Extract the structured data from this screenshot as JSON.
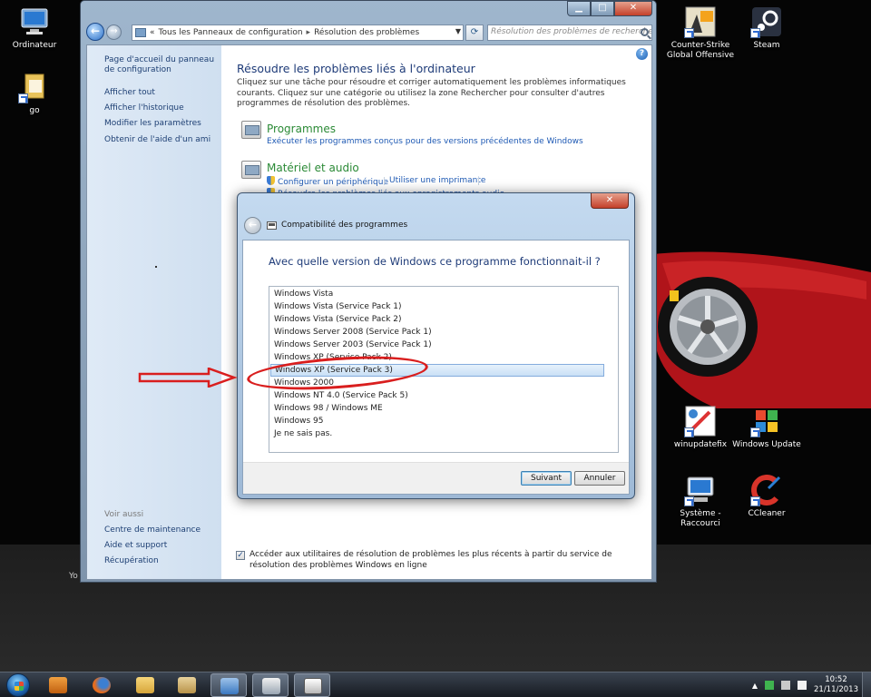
{
  "desktop": {
    "icons": [
      {
        "label": "Ordinateur"
      },
      {
        "label": "go"
      },
      {
        "label": "Counter-Strike Global Offensive"
      },
      {
        "label": "Steam"
      },
      {
        "label": "winupdatefix"
      },
      {
        "label": "Windows Update"
      },
      {
        "label": "Système - Raccourci"
      },
      {
        "label": "CCleaner"
      }
    ],
    "stray_text": "Yo"
  },
  "window": {
    "addr": {
      "part1": "Tous les Panneaux de configuration",
      "part2": "Résolution des problèmes"
    },
    "search_placeholder": "Résolution des problèmes de recherche",
    "left_pane": {
      "links": [
        "Page d'accueil du panneau de configuration",
        "Afficher tout",
        "Afficher l'historique",
        "Modifier les paramètres",
        "Obtenir de l'aide d'un ami"
      ],
      "see_also_heading": "Voir aussi",
      "see_also": [
        "Centre de maintenance",
        "Aide et support",
        "Récupération"
      ]
    },
    "title": "Résoudre les problèmes liés à l'ordinateur",
    "intro": "Cliquez sur une tâche pour résoudre et corriger automatiquement les problèmes informatiques courants. Cliquez sur une catégorie ou utilisez la zone Rechercher pour consulter d'autres programmes de résolution des problèmes.",
    "categories": {
      "programmes": {
        "title": "Programmes",
        "link1": "Exécuter les programmes conçus pour des versions précédentes de Windows"
      },
      "materiel": {
        "title": "Matériel et audio",
        "link1": "Configurer un périphérique",
        "link2": "Utiliser une imprimante",
        "link3": "Résoudre les problèmes liés aux enregistrements audio"
      }
    },
    "checkbox_label": "Accéder aux utilitaires de résolution de problèmes les plus récents à partir du service de résolution des problèmes Windows en ligne",
    "checkbox_checked": true
  },
  "dialog": {
    "title": "Compatibilité des programmes",
    "heading": "Avec quelle version de Windows ce programme fonctionnait-il ?",
    "options": [
      "Windows Vista",
      "Windows Vista (Service Pack 1)",
      "Windows Vista (Service Pack 2)",
      "Windows Server 2008 (Service Pack 1)",
      "Windows Server 2003 (Service Pack 1)",
      "Windows XP (Service Pack 2)",
      "Windows XP (Service Pack 3)",
      "Windows 2000",
      "Windows NT 4.0 (Service Pack 5)",
      "Windows 98 / Windows ME",
      "Windows 95",
      "Je ne sais pas."
    ],
    "selected_option": "Windows XP (Service Pack 3)",
    "next_label": "Suivant",
    "cancel_label": "Annuler"
  },
  "taskbar": {
    "time": "10:52",
    "date": "21/11/2013"
  },
  "colors": {
    "accent": "#1e3b78",
    "link": "#1f5ab4",
    "category_title": "#2b8a36",
    "annotation": "#d91e1e"
  }
}
